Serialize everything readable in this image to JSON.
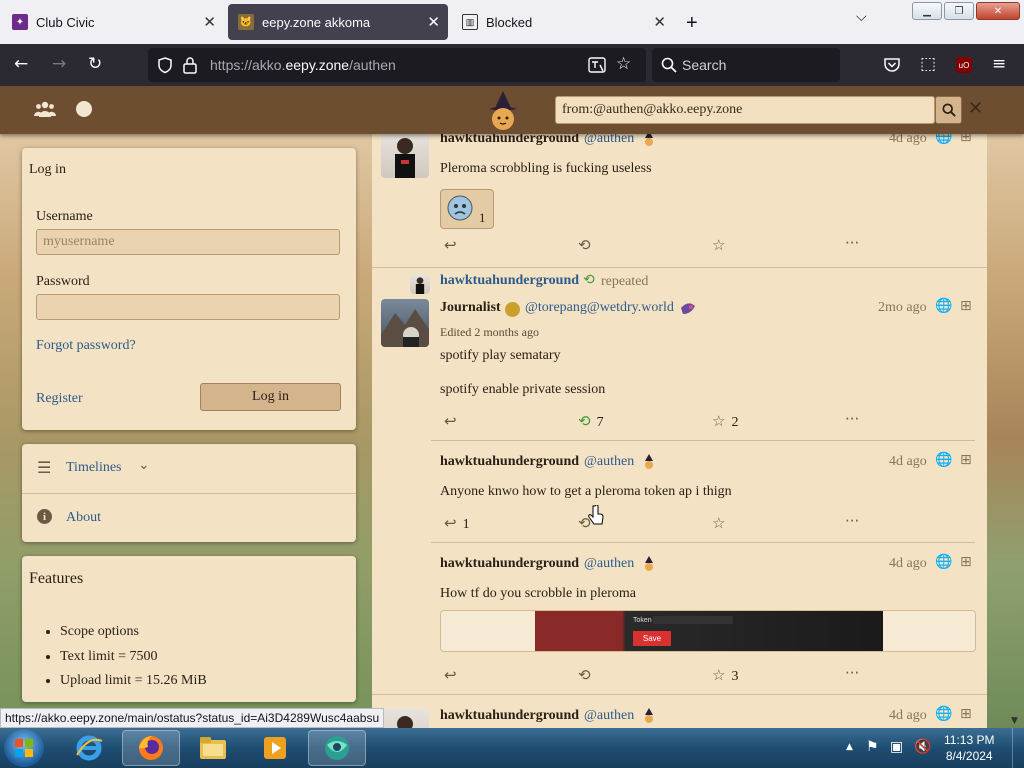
{
  "browser": {
    "tabs": [
      {
        "title": "Club Civic",
        "active": false
      },
      {
        "title": "eepy.zone akkoma",
        "active": true
      },
      {
        "title": "Blocked",
        "active": false
      }
    ],
    "url_prefix": "https://akko.",
    "url_domain": "eepy.zone",
    "url_rest": "/authen",
    "search_placeholder": "Search",
    "status_url": "https://akko.eepy.zone/main/ostatus?status_id=Ai3D4289Wusc4aabsu"
  },
  "topbar": {
    "search_value": "from:@authen@akko.eepy.zone"
  },
  "login": {
    "title": "Log in",
    "username_label": "Username",
    "username_placeholder": "myusername",
    "password_label": "Password",
    "forgot": "Forgot password?",
    "register": "Register",
    "login_button": "Log in"
  },
  "nav": {
    "timelines": "Timelines",
    "about": "About"
  },
  "features": {
    "title": "Features",
    "items": [
      "Scope options",
      "Text limit = 7500",
      "Upload limit = 15.26 MiB"
    ]
  },
  "posts": [
    {
      "user": "hawktuahunderground",
      "handle": "@authen",
      "time": "4d ago",
      "text": "Pleroma scrobbling is fucking useless",
      "reaction_count": "1"
    },
    {
      "repeat_by": "hawktuahunderground",
      "repeat_label": "repeated",
      "user": "Journalist",
      "handle": "@torepang@wetdry.world",
      "time": "2mo ago",
      "edited": "Edited 2 months ago",
      "text1": "spotify play sematary",
      "text2": "spotify enable private session",
      "repeats": "7",
      "favs": "2"
    },
    {
      "user": "hawktuahunderground",
      "handle": "@authen",
      "time": "4d ago",
      "text": "Anyone knwo how to get a pleroma token  ap i thign",
      "replies": "1"
    },
    {
      "user": "hawktuahunderground",
      "handle": "@authen",
      "time": "4d ago",
      "text": "How tf do you scrobble in pleroma",
      "attachment_label": "Token",
      "attachment_button": "Save",
      "favs": "3"
    },
    {
      "user": "hawktuahunderground",
      "handle": "@authen",
      "time": "4d ago"
    }
  ],
  "taskbar": {
    "time": "11:13 PM",
    "date": "8/4/2024"
  }
}
